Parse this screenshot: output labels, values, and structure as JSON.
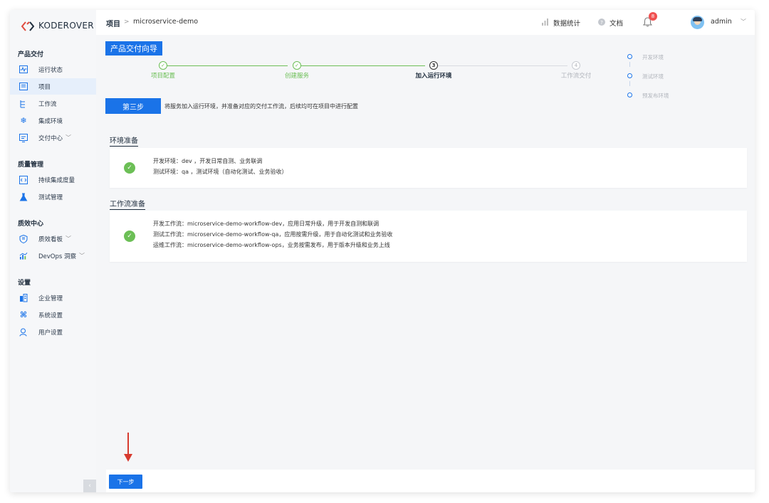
{
  "app": {
    "logo_text": "KODEROVER"
  },
  "colors": {
    "accent": "#1a73e8",
    "success": "#6cbf56",
    "step_done": "#6cbf56",
    "annotation_arrow": "#d73a2f"
  },
  "sidebar": {
    "sections": [
      {
        "title": "产品交付",
        "items": [
          {
            "label": "运行状态",
            "icon": "pulse-icon"
          },
          {
            "label": "项目",
            "icon": "project-icon",
            "active": true
          },
          {
            "label": "工作流",
            "icon": "workflow-icon"
          },
          {
            "label": "集成环境",
            "icon": "snowflake-icon"
          },
          {
            "label": "交付中心",
            "icon": "delivery-icon",
            "expandable": true
          }
        ]
      },
      {
        "title": "质量管理",
        "items": [
          {
            "label": "持续集成度量",
            "icon": "code-icon"
          },
          {
            "label": "测试管理",
            "icon": "flask-icon"
          }
        ]
      },
      {
        "title": "质效中心",
        "items": [
          {
            "label": "质效看板",
            "icon": "shield-icon",
            "expandable": true
          },
          {
            "label": "DevOps 洞察",
            "icon": "insight-icon",
            "expandable": true
          }
        ]
      },
      {
        "title": "设置",
        "items": [
          {
            "label": "企业管理",
            "icon": "building-icon"
          },
          {
            "label": "系统设置",
            "icon": "system-icon"
          },
          {
            "label": "用户设置",
            "icon": "user-icon"
          }
        ]
      }
    ],
    "collapse_glyph": "‹"
  },
  "header": {
    "breadcrumb_root": "项目",
    "breadcrumb_sep": ">",
    "breadcrumb_leaf": "microservice-demo",
    "stats_label": "数据统计",
    "docs_label": "文档",
    "notification_count": "8",
    "username": "admin"
  },
  "wizard": {
    "title": "产品交付向导",
    "steps": [
      {
        "label": "项目配置",
        "mark": "✓",
        "state": "done"
      },
      {
        "label": "创建服务",
        "mark": "✓",
        "state": "done"
      },
      {
        "label": "加入运行环境",
        "mark": "3",
        "state": "current"
      },
      {
        "label": "工作流交付",
        "mark": "4",
        "state": "pending"
      }
    ],
    "env_list": [
      "开发环境",
      "测试环境",
      "预发布环境"
    ],
    "current_step_tag": "第三步",
    "current_step_desc": "将服务加入运行环境，并准备对应的交付工作流，后续均可在项目中进行配置"
  },
  "env_section": {
    "heading": "环境准备",
    "lines": [
      "开发环境：dev ，开发日常自测、业务联调",
      "测试环境：qa ，测试环境（自动化测试、业务验收）"
    ]
  },
  "workflow_section": {
    "heading": "工作流准备",
    "lines": [
      "开发工作流：microservice-demo-workflow-dev，应用日常升级，用于开发自测和联调",
      "测试工作流：microservice-demo-workflow-qa，应用按需升级，用于自动化测试和业务验收",
      "运维工作流：microservice-demo-workflow-ops，业务按需发布，用于版本升级和业务上线"
    ]
  },
  "footer": {
    "next_label": "下一步"
  }
}
